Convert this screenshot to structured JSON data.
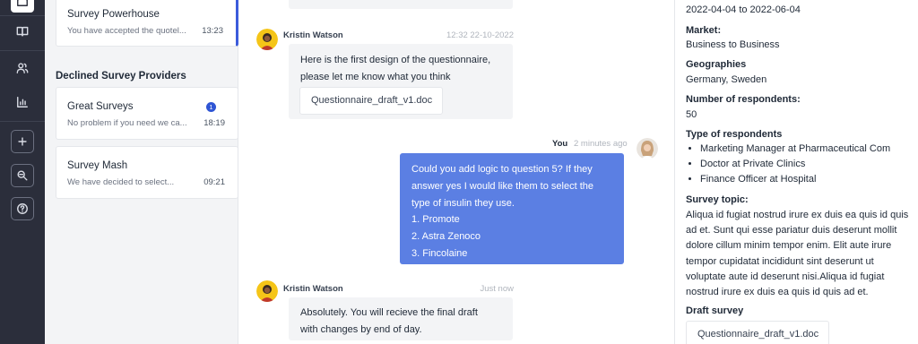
{
  "rail": {
    "icons": [
      "home-icon",
      "book-icon",
      "users-icon",
      "bar-chart-icon",
      "plus-icon",
      "chat-search-icon",
      "help-icon"
    ]
  },
  "providers": {
    "accepted": [
      {
        "name": "Survey Powerhouse",
        "preview": "You have accepted the quotel...",
        "time": "13:23"
      }
    ],
    "declined_title": "Declined Survey Providers",
    "declined": [
      {
        "name": "Great Surveys",
        "preview": "No problem if you need we ca...",
        "time": "18:19",
        "badge": "1"
      },
      {
        "name": "Survey Mash",
        "preview": "We have decided to select...",
        "time": "09:21"
      }
    ]
  },
  "chat": {
    "messages": [
      {
        "author": "Kristin Watson",
        "stamp": "12:32 22-10-2022",
        "lines": [
          "Here is the first design of the questionnaire,",
          "please let me know what you think"
        ],
        "attachment": "Questionnaire_draft_v1.doc"
      },
      {
        "author": "You",
        "stamp": "2 minutes ago",
        "lines": [
          "Could you add logic to question 5? If they",
          "answer yes I would like them to select the",
          "type of insulin they use.",
          "1. Promote",
          "2. Astra Zenoco",
          "3. Fincolaine"
        ]
      },
      {
        "author": "Kristin Watson",
        "stamp": "Just now",
        "lines": [
          "Absolutely. You will recieve the final draft",
          "with changes by end of day."
        ]
      }
    ]
  },
  "details": {
    "dates": "2022-04-04 to 2022-06-04",
    "market_label": "Market:",
    "market": "Business to Business",
    "geo_label": "Geographies",
    "geo": "Germany, Sweden",
    "respondents_label": "Number of respondents:",
    "respondents": "50",
    "type_label": "Type of respondents",
    "types": [
      "Marketing Manager at Pharmaceutical Com",
      "Doctor at Private Clinics",
      "Finance Officer at Hospital"
    ],
    "topic_label": "Survey topic:",
    "topic": "Aliqua id fugiat nostrud irure ex duis ea quis id quis ad et. Sunt qui esse pariatur duis deserunt mollit dolore cillum minim tempor enim. Elit aute irure tempor cupidatat incididunt sint deserunt ut voluptate aute id deserunt nisi.Aliqua id fugiat nostrud irure ex duis ea quis id quis ad et.",
    "draft_label": "Draft survey",
    "draft_file": "Questionnaire_draft_v1.doc"
  }
}
